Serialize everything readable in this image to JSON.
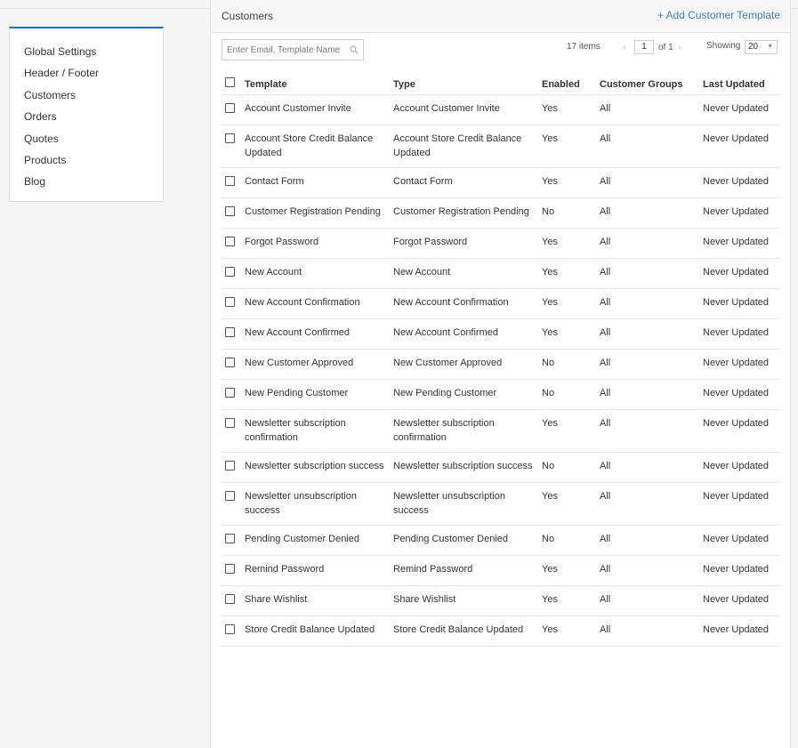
{
  "sidebar": {
    "items": [
      {
        "label": "Global Settings"
      },
      {
        "label": "Header / Footer"
      },
      {
        "label": "Customers"
      },
      {
        "label": "Orders"
      },
      {
        "label": "Quotes"
      },
      {
        "label": "Products"
      },
      {
        "label": "Blog"
      }
    ]
  },
  "panel": {
    "title": "Customers",
    "add_link": "+ Add Customer Template"
  },
  "toolbar": {
    "search_placeholder": "Enter Email, Template Name",
    "items_count": "17 items",
    "page_current": "1",
    "page_total": "of 1",
    "showing_label": "Showing",
    "showing_value": "20"
  },
  "table": {
    "headers": {
      "template": "Template",
      "type": "Type",
      "enabled": "Enabled",
      "customer_groups": "Customer Groups",
      "last_updated": "Last Updated"
    },
    "rows": [
      {
        "template": "Account Customer Invite",
        "type": "Account Customer Invite",
        "enabled": "Yes",
        "customer_groups": "All",
        "last_updated": "Never Updated"
      },
      {
        "template": "Account Store Credit Balance Updated",
        "type": "Account Store Credit Balance Updated",
        "enabled": "Yes",
        "customer_groups": "All",
        "last_updated": "Never Updated"
      },
      {
        "template": "Contact Form",
        "type": "Contact Form",
        "enabled": "Yes",
        "customer_groups": "All",
        "last_updated": "Never Updated"
      },
      {
        "template": "Customer Registration Pending",
        "type": "Customer Registration Pending",
        "enabled": "No",
        "customer_groups": "All",
        "last_updated": "Never Updated"
      },
      {
        "template": "Forgot Password",
        "type": "Forgot Password",
        "enabled": "Yes",
        "customer_groups": "All",
        "last_updated": "Never Updated"
      },
      {
        "template": "New Account",
        "type": "New Account",
        "enabled": "Yes",
        "customer_groups": "All",
        "last_updated": "Never Updated"
      },
      {
        "template": "New Account Confirmation",
        "type": "New Account Confirmation",
        "enabled": "Yes",
        "customer_groups": "All",
        "last_updated": "Never Updated"
      },
      {
        "template": "New Account Confirmed",
        "type": "New Account Confirmed",
        "enabled": "Yes",
        "customer_groups": "All",
        "last_updated": "Never Updated"
      },
      {
        "template": "New Customer Approved",
        "type": "New Customer Approved",
        "enabled": "No",
        "customer_groups": "All",
        "last_updated": "Never Updated"
      },
      {
        "template": "New Pending Customer",
        "type": "New Pending Customer",
        "enabled": "No",
        "customer_groups": "All",
        "last_updated": "Never Updated"
      },
      {
        "template": "Newsletter subscription confirmation",
        "type": "Newsletter subscription confirmation",
        "enabled": "Yes",
        "customer_groups": "All",
        "last_updated": "Never Updated"
      },
      {
        "template": "Newsletter subscription success",
        "type": "Newsletter subscription success",
        "enabled": "No",
        "customer_groups": "All",
        "last_updated": "Never Updated"
      },
      {
        "template": "Newsletter unsubscription success",
        "type": "Newsletter unsubscription success",
        "enabled": "Yes",
        "customer_groups": "All",
        "last_updated": "Never Updated"
      },
      {
        "template": "Pending Customer Denied",
        "type": "Pending Customer Denied",
        "enabled": "No",
        "customer_groups": "All",
        "last_updated": "Never Updated"
      },
      {
        "template": "Remind Password",
        "type": "Remind Password",
        "enabled": "Yes",
        "customer_groups": "All",
        "last_updated": "Never Updated"
      },
      {
        "template": "Share Wishlist",
        "type": "Share Wishlist",
        "enabled": "Yes",
        "customer_groups": "All",
        "last_updated": "Never Updated"
      },
      {
        "template": "Store Credit Balance Updated",
        "type": "Store Credit Balance Updated",
        "enabled": "Yes",
        "customer_groups": "All",
        "last_updated": "Never Updated"
      }
    ]
  },
  "colors": {
    "accent": "#1f70b8",
    "link": "#3b7fc4",
    "enabled_yes": "#2e8b3d",
    "enabled_no": "#d92b1b"
  }
}
